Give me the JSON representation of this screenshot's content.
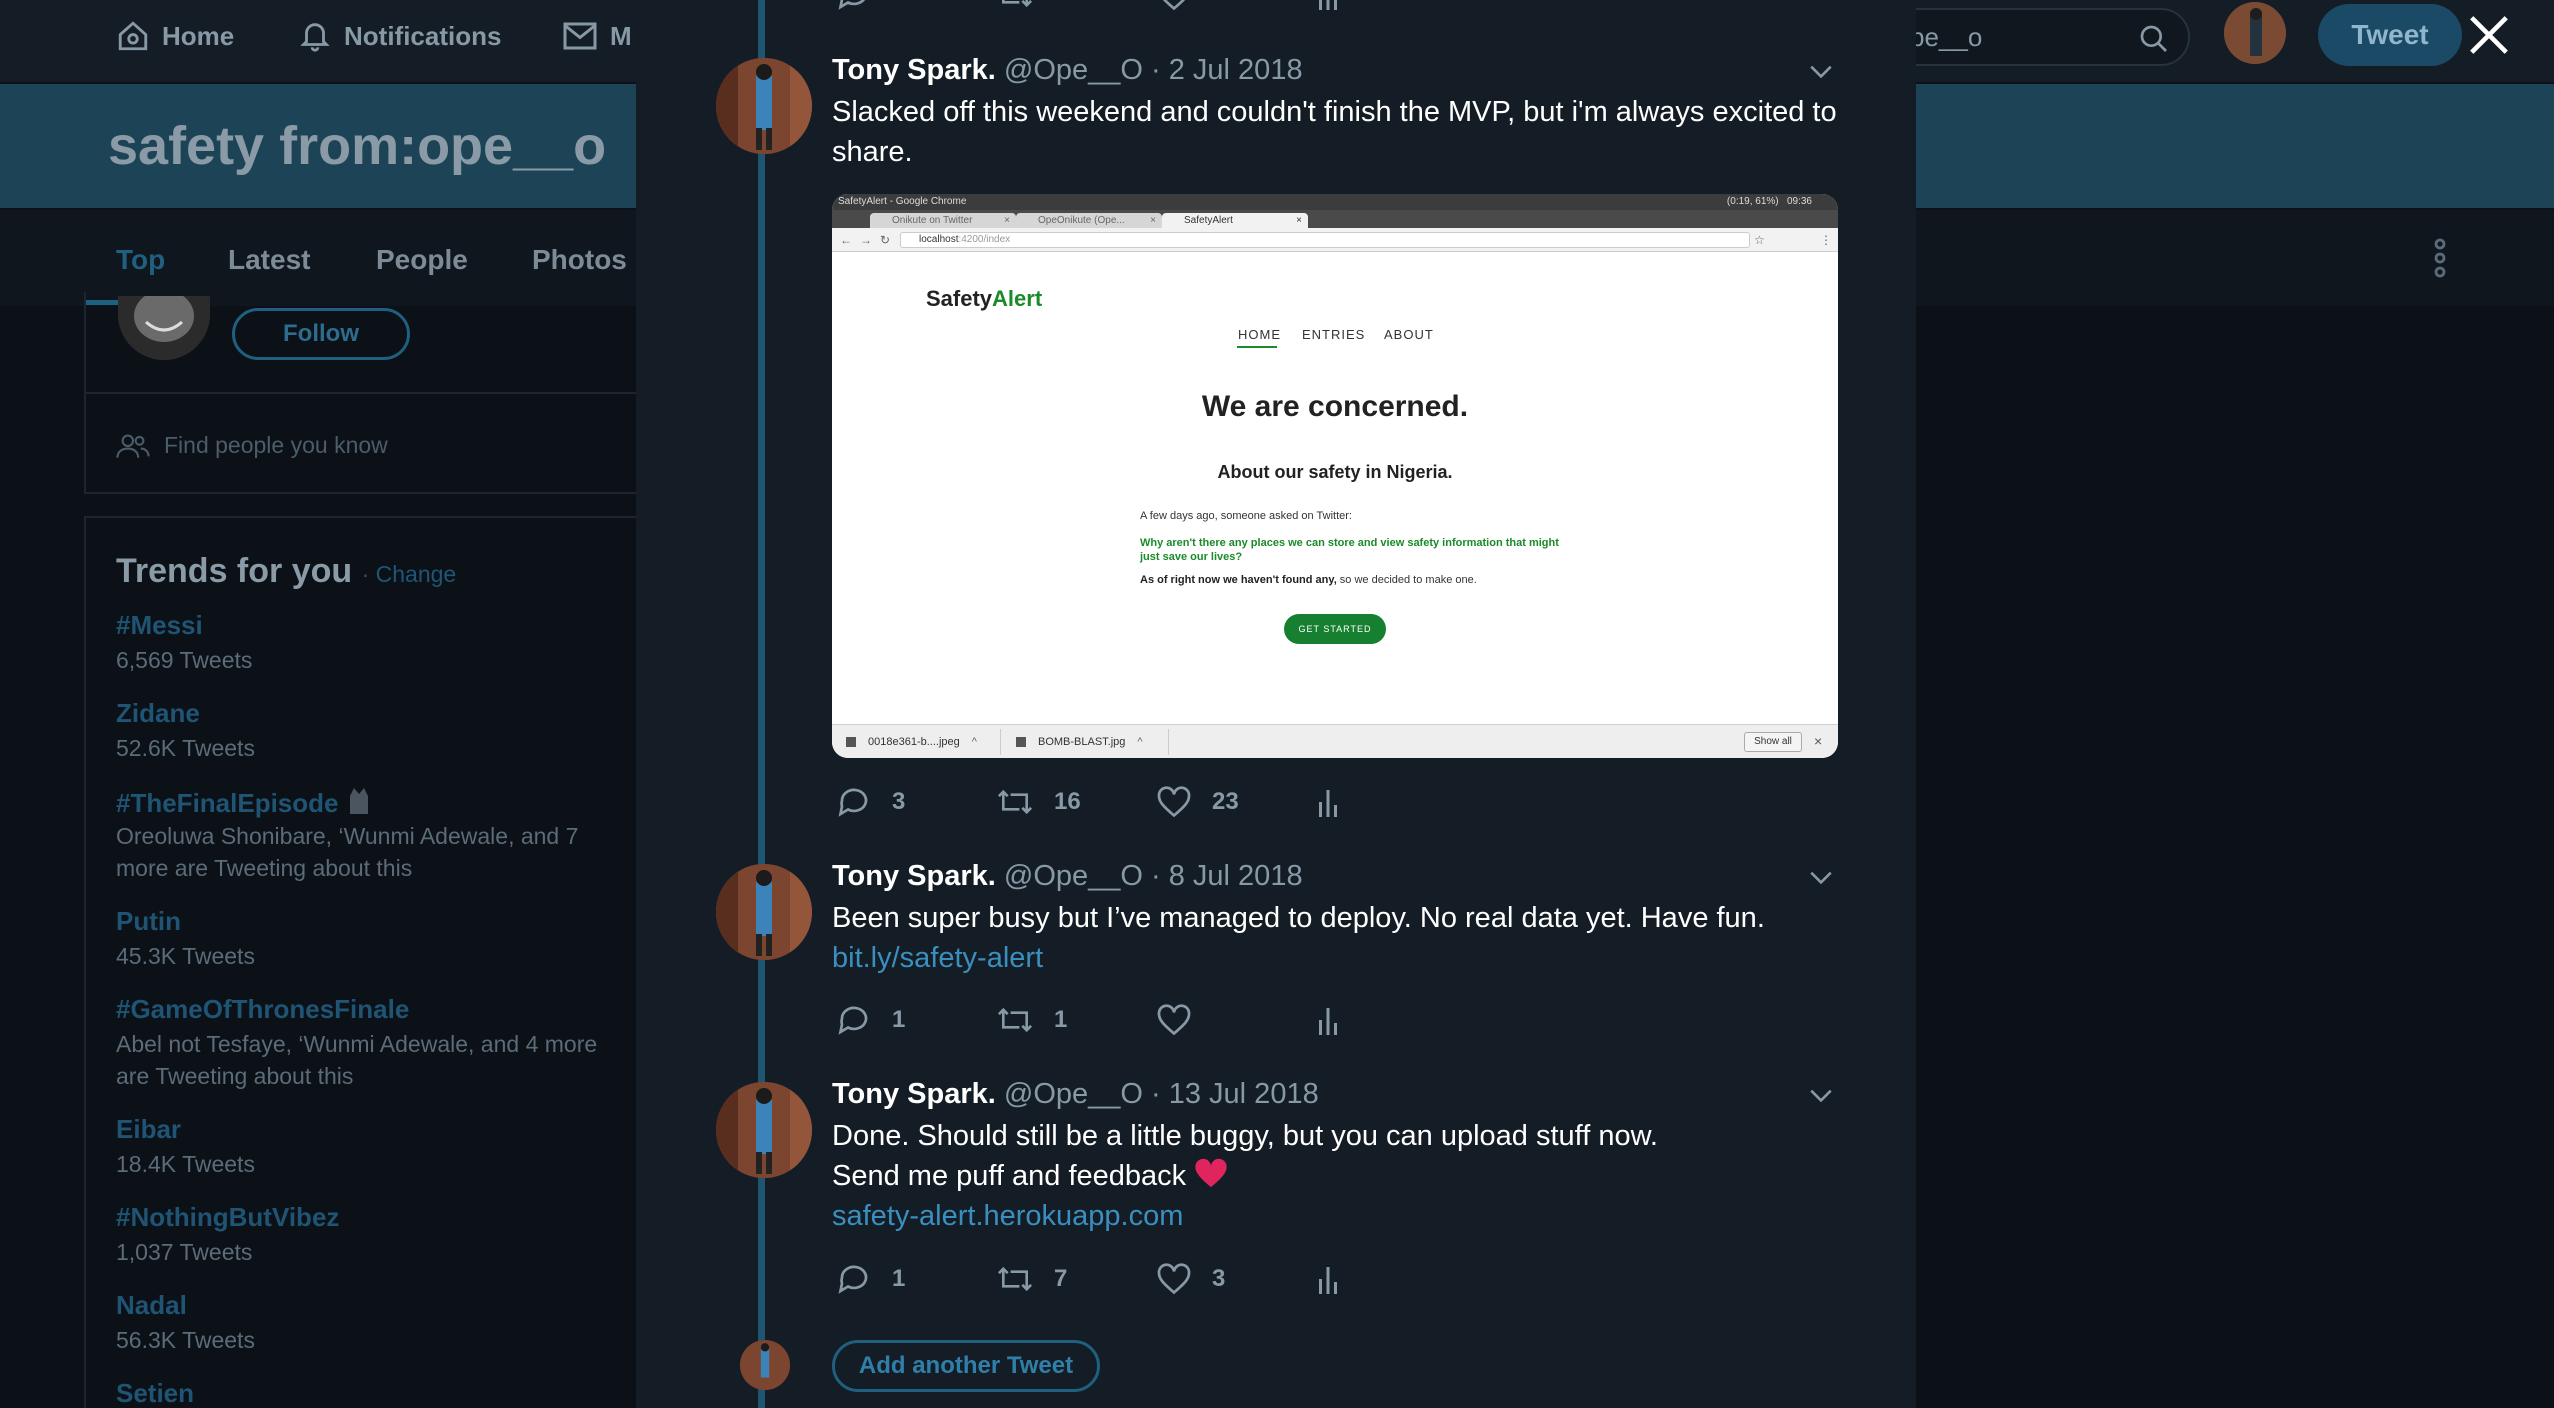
{
  "nav": {
    "home": "Home",
    "notifications": "Notifications",
    "messages_partial": "M",
    "search_value": "pe__o",
    "tweet_button": "Tweet"
  },
  "search": {
    "title": "safety from:ope__o",
    "tabs": [
      "Top",
      "Latest",
      "People",
      "Photos"
    ],
    "active_tab": "Top"
  },
  "sidebar": {
    "follow_button": "Follow",
    "find_people": "Find people you know",
    "trends_title": "Trends for you",
    "trends_change": "· Change",
    "trends": [
      {
        "name": "#Messi",
        "sub": "6,569 Tweets"
      },
      {
        "name": "Zidane",
        "sub": "52.6K Tweets"
      },
      {
        "name": "#TheFinalEpisode",
        "sub": "Oreoluwa Shonibare, ‘Wunmi Adewale, and 7 more are Tweeting about this"
      },
      {
        "name": "Putin",
        "sub": "45.3K Tweets"
      },
      {
        "name": "#GameOfThronesFinale",
        "sub": "Abel not Tesfaye, ‘Wunmi Adewale, and 4 more are Tweeting about this"
      },
      {
        "name": "Eibar",
        "sub": "18.4K Tweets"
      },
      {
        "name": "#NothingButVibez",
        "sub": "1,037 Tweets"
      },
      {
        "name": "Nadal",
        "sub": "56.3K Tweets"
      },
      {
        "name": "Setien",
        "sub": ""
      }
    ]
  },
  "thread": {
    "tweets": [
      {
        "name": "Tony Spark.",
        "meta": "@Ope__O · 2 Jul 2018",
        "text1": "Slacked off this weekend and couldn't finish the MVP, but i'm always excited to",
        "text2": "share.",
        "replies": "3",
        "retweets": "16",
        "likes": "23"
      },
      {
        "name": "Tony Spark.",
        "meta": "@Ope__O · 8 Jul 2018",
        "text1": "Been super busy but I’ve managed to deploy. No real data yet. Have fun.",
        "link": "bit.ly/safety-alert",
        "replies": "1",
        "retweets": "1",
        "likes": ""
      },
      {
        "name": "Tony Spark.",
        "meta": "@Ope__O · 13 Jul 2018",
        "text1": "Done. Should still be a little buggy, but you can upload stuff now.",
        "text2": "Send me puff and feedback",
        "link": "safety-alert.herokuapp.com",
        "replies": "1",
        "retweets": "7",
        "likes": "3"
      }
    ],
    "add_another": "Add another Tweet"
  },
  "screenshot": {
    "window_title": "SafetyAlert - Google Chrome",
    "status": "(0:19, 61%)",
    "time": "09:36",
    "tabs": [
      "Onikute on Twitter",
      "OpeOnikute (Ope...",
      "SafetyAlert"
    ],
    "url_host": "localhost",
    "url_rest": ":4200/index",
    "logo_a": "Safety",
    "logo_b": "Alert",
    "nav": [
      "HOME",
      "ENTRIES",
      "ABOUT"
    ],
    "headline": "We are concerned.",
    "subhead": "About our safety in Nigeria.",
    "p1": "A few days ago, someone asked on Twitter:",
    "p2": "Why aren't there any places we can store and view safety information that might just save our lives?",
    "p3_bold": "As of right now we haven't found any,",
    "p3_rest": " so we decided to make one.",
    "cta": "GET STARTED",
    "downloads": [
      "0018e361-b....jpeg",
      "BOMB-BLAST.jpg"
    ],
    "show_all": "Show all"
  },
  "colors": {
    "accent": "#1f5f80",
    "link": "#3a8fbf",
    "heart": "#e0245e",
    "site_green": "#1a8a2a"
  }
}
